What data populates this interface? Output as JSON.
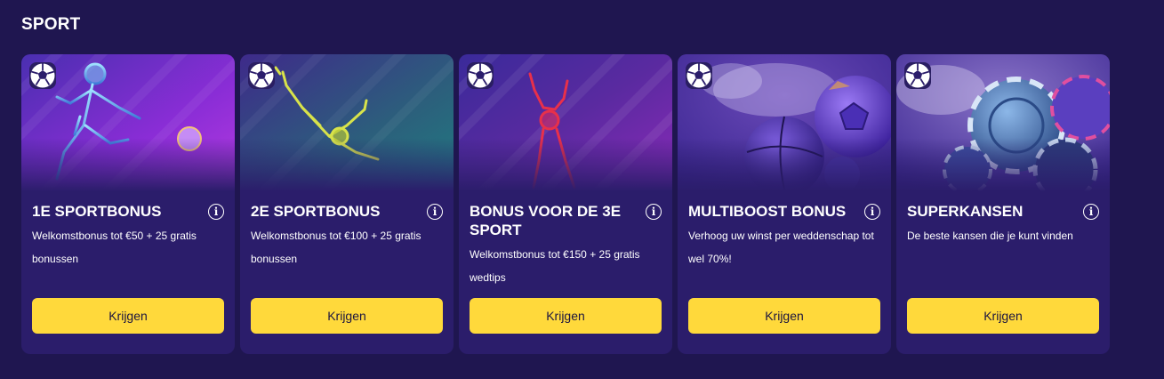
{
  "section": {
    "title": "SPORT"
  },
  "cards": [
    {
      "title": "1E SPORTBONUS",
      "description": "Welkomstbonus tot €50 + 25 gratis bonussen",
      "button_label": "Krijgen",
      "image": "soccer-player-kick",
      "badge_icon": "soccer-ball-icon"
    },
    {
      "title": "2E SPORTBONUS",
      "description": "Welkomstbonus tot €100 + 25 gratis bonussen",
      "button_label": "Krijgen",
      "image": "goalkeeper-dive",
      "badge_icon": "soccer-ball-icon"
    },
    {
      "title": "BONUS VOOR DE 3E SPORT",
      "description": "Welkomstbonus tot €150 + 25 gratis wedtips",
      "button_label": "Krijgen",
      "image": "player-celebration",
      "badge_icon": "soccer-ball-icon"
    },
    {
      "title": "MULTIBOOST BONUS",
      "description": "Verhoog uw winst per weddenschap tot wel 70%!",
      "button_label": "Krijgen",
      "image": "sport-balls",
      "badge_icon": "soccer-ball-icon"
    },
    {
      "title": "SUPERKANSEN",
      "description": "De beste kansen die je kunt vinden",
      "button_label": "Krijgen",
      "image": "casino-chips",
      "badge_icon": "soccer-ball-icon"
    }
  ],
  "colors": {
    "background": "#1f1650",
    "card": "#2b1d6b",
    "button": "#ffd93b",
    "button_text": "#1d1640"
  }
}
